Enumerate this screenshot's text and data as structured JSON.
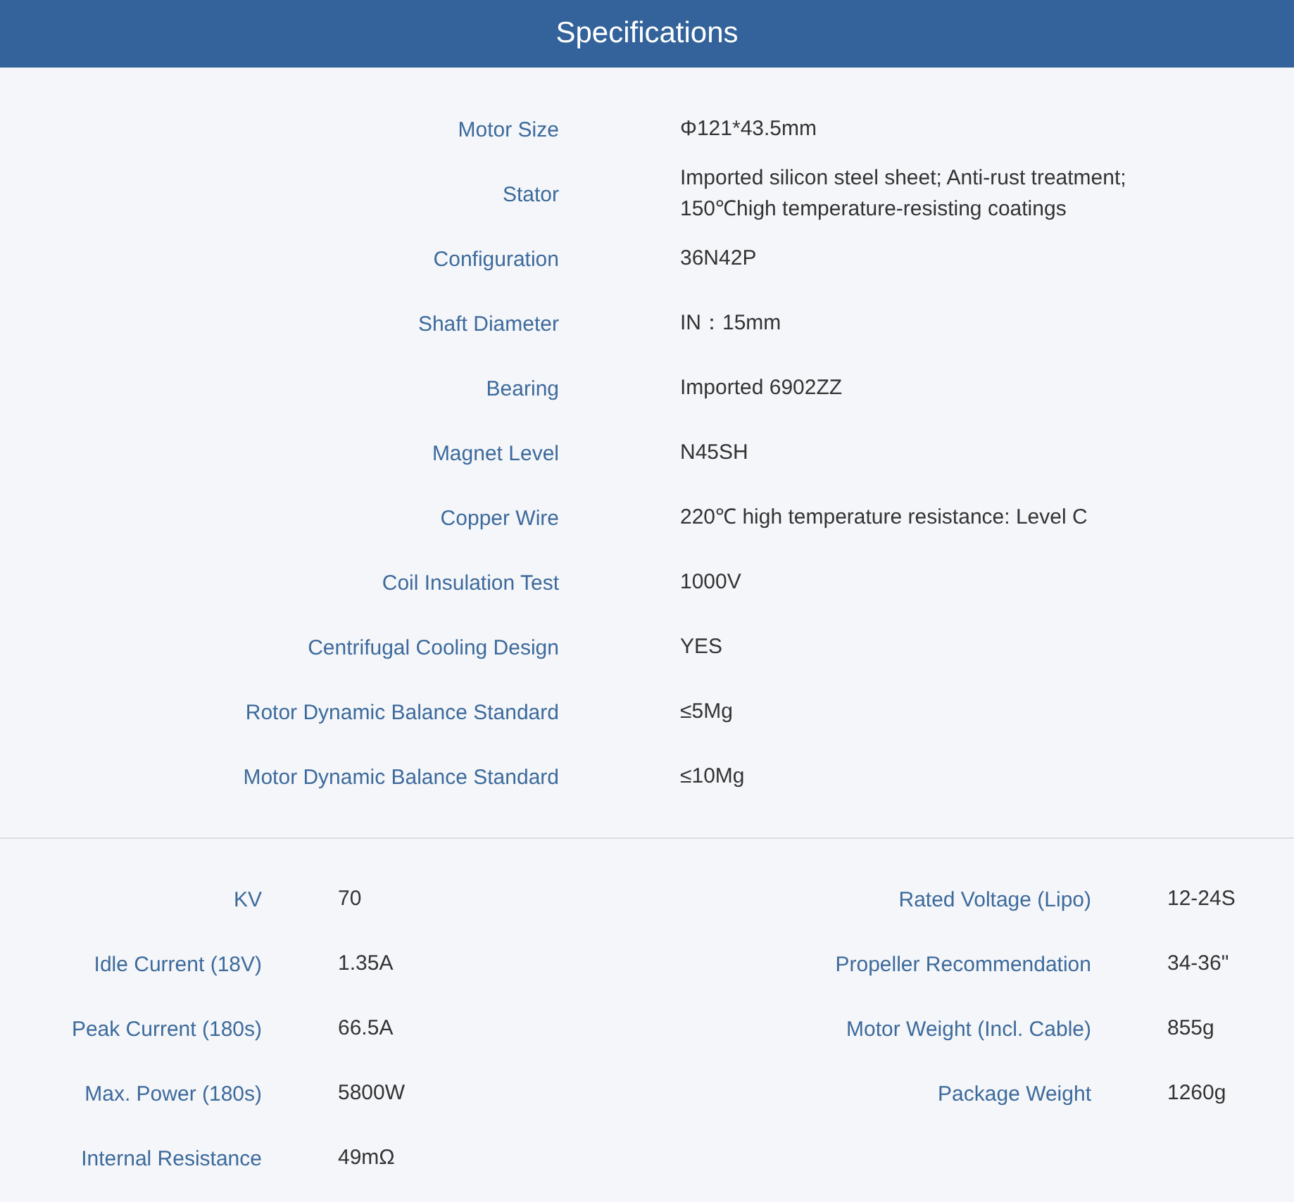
{
  "header": {
    "title": "Specifications"
  },
  "specs": [
    {
      "label": "Motor Size",
      "value": [
        "Φ121*43.5mm"
      ]
    },
    {
      "label": "Stator",
      "value": [
        "Imported silicon steel sheet; Anti-rust treatment;",
        "150℃high temperature-resisting coatings"
      ]
    },
    {
      "label": "Configuration",
      "value": [
        "36N42P"
      ]
    },
    {
      "label": "Shaft Diameter",
      "value": [
        "IN：15mm"
      ]
    },
    {
      "label": "Bearing",
      "value": [
        "Imported 6902ZZ"
      ]
    },
    {
      "label": "Magnet Level",
      "value": [
        "N45SH"
      ]
    },
    {
      "label": "Copper Wire",
      "value": [
        "220℃ high temperature resistance: Level C"
      ]
    },
    {
      "label": "Coil Insulation Test",
      "value": [
        "1000V"
      ]
    },
    {
      "label": "Centrifugal Cooling Design",
      "value": [
        "YES"
      ]
    },
    {
      "label": "Rotor Dynamic Balance Standard",
      "value": [
        "≤5Mg"
      ]
    },
    {
      "label": "Motor Dynamic Balance Standard",
      "value": [
        "≤10Mg"
      ]
    }
  ],
  "parameters": [
    [
      {
        "label": "KV",
        "value": "70"
      },
      {
        "label": "Rated Voltage (Lipo)",
        "value": "12-24S"
      }
    ],
    [
      {
        "label": "Idle Current (18V)",
        "value": "1.35A"
      },
      {
        "label": "Propeller Recommendation",
        "value": "34-36\""
      }
    ],
    [
      {
        "label": "Peak Current (180s)",
        "value": "66.5A"
      },
      {
        "label": "Motor Weight (Incl. Cable)",
        "value": "855g"
      }
    ],
    [
      {
        "label": "Max. Power (180s)",
        "value": "5800W"
      },
      {
        "label": "Package Weight",
        "value": "1260g"
      }
    ],
    [
      {
        "label": "Internal Resistance",
        "value": "49mΩ"
      }
    ]
  ]
}
